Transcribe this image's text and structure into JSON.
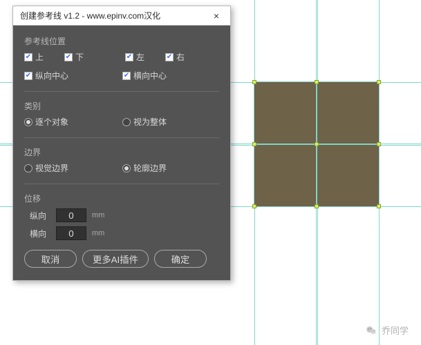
{
  "dialog": {
    "title": "创建参考线 v1.2 - www.epinv.com汉化",
    "close": "×",
    "sections": {
      "position": {
        "label": "参考线位置",
        "checks": {
          "top": "上",
          "bottom": "下",
          "left": "左",
          "right": "右",
          "vcenter": "纵向中心",
          "hcenter": "横向中心"
        }
      },
      "category": {
        "label": "类别",
        "each": "逐个对象",
        "whole": "视为整体"
      },
      "bounds": {
        "label": "边界",
        "visual": "视觉边界",
        "outline": "轮廓边界"
      },
      "offset": {
        "label": "位移",
        "v_label": "纵向",
        "v_value": "0",
        "v_unit": "mm",
        "h_label": "横向",
        "h_value": "0",
        "h_unit": "mm"
      }
    },
    "buttons": {
      "cancel": "取消",
      "more": "更多AI插件",
      "ok": "确定"
    }
  },
  "credit": {
    "text": "乔同学"
  }
}
